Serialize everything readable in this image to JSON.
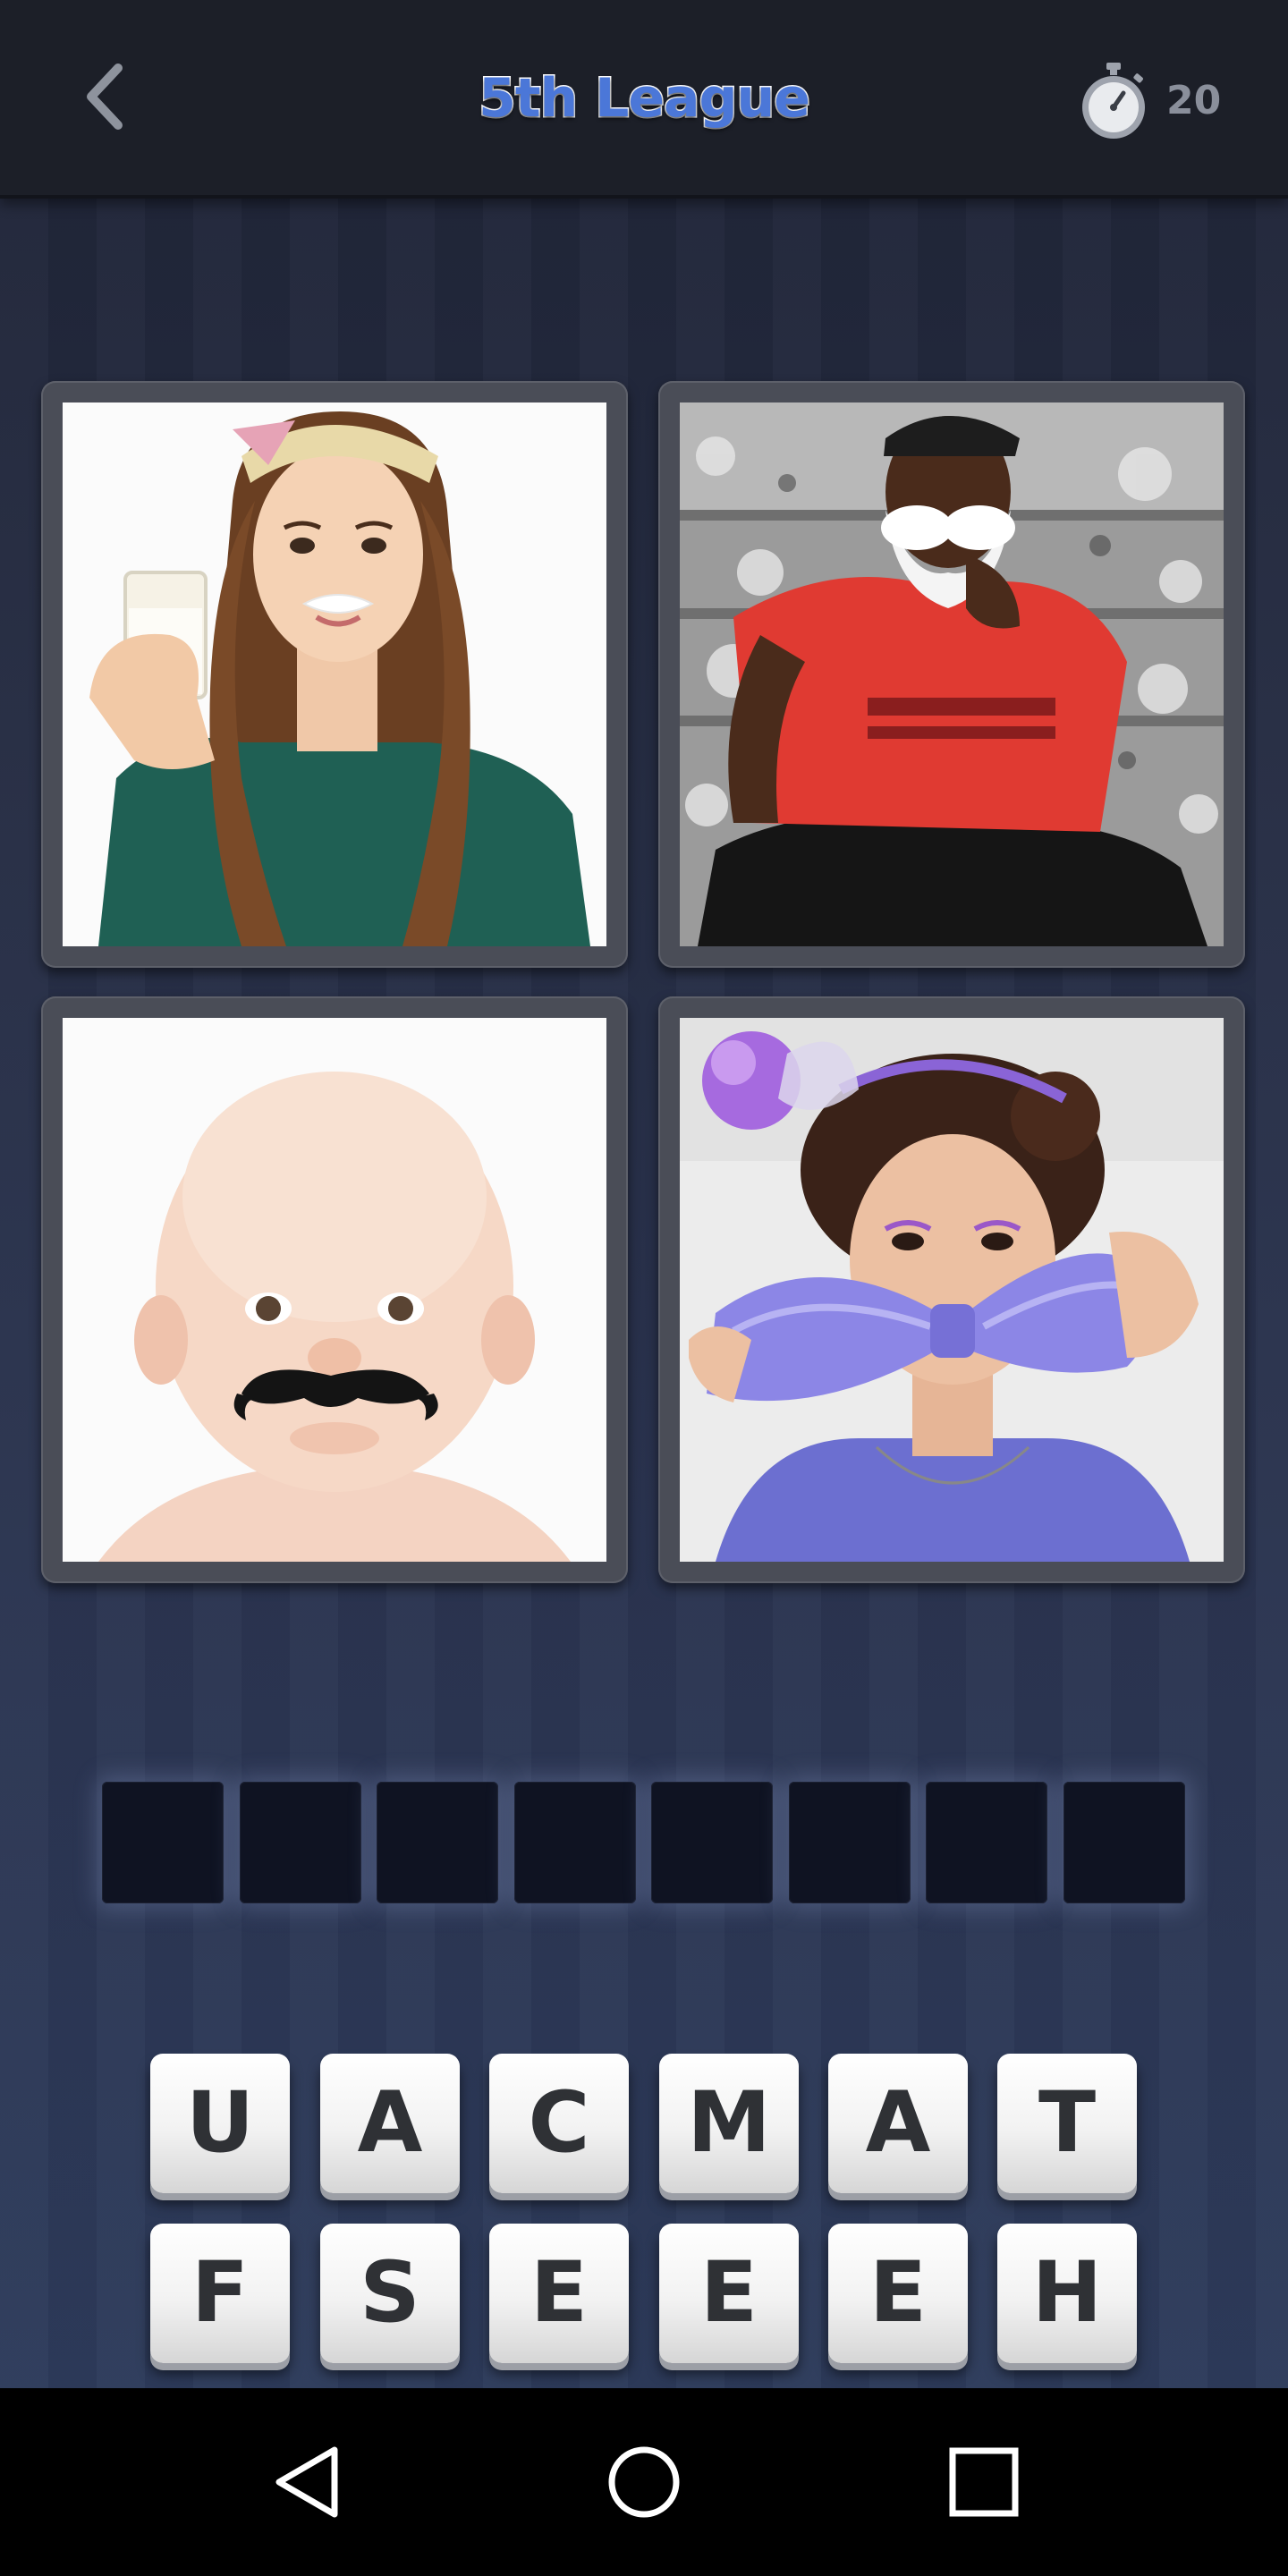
{
  "header": {
    "title": "5th League",
    "timer_value": "20",
    "back_icon": "chevron-left-icon",
    "timer_icon": "stopwatch-icon"
  },
  "puzzle": {
    "images": [
      "girl-milk-mustache",
      "man-white-mustache",
      "baby-fake-mustache",
      "woman-purple-bow-mustache"
    ],
    "answer_length": 8,
    "letters_row1": [
      "U",
      "A",
      "C",
      "M",
      "A",
      "T"
    ],
    "letters_row2": [
      "F",
      "S",
      "E",
      "E",
      "E",
      "H"
    ]
  },
  "navbar": {
    "back": "triangle-back-icon",
    "home": "circle-home-icon",
    "recents": "square-recents-icon"
  },
  "colors": {
    "title_blue": "#4b77d8",
    "slot_dark": "#0f1322",
    "key_face": "#f2f2f2"
  }
}
